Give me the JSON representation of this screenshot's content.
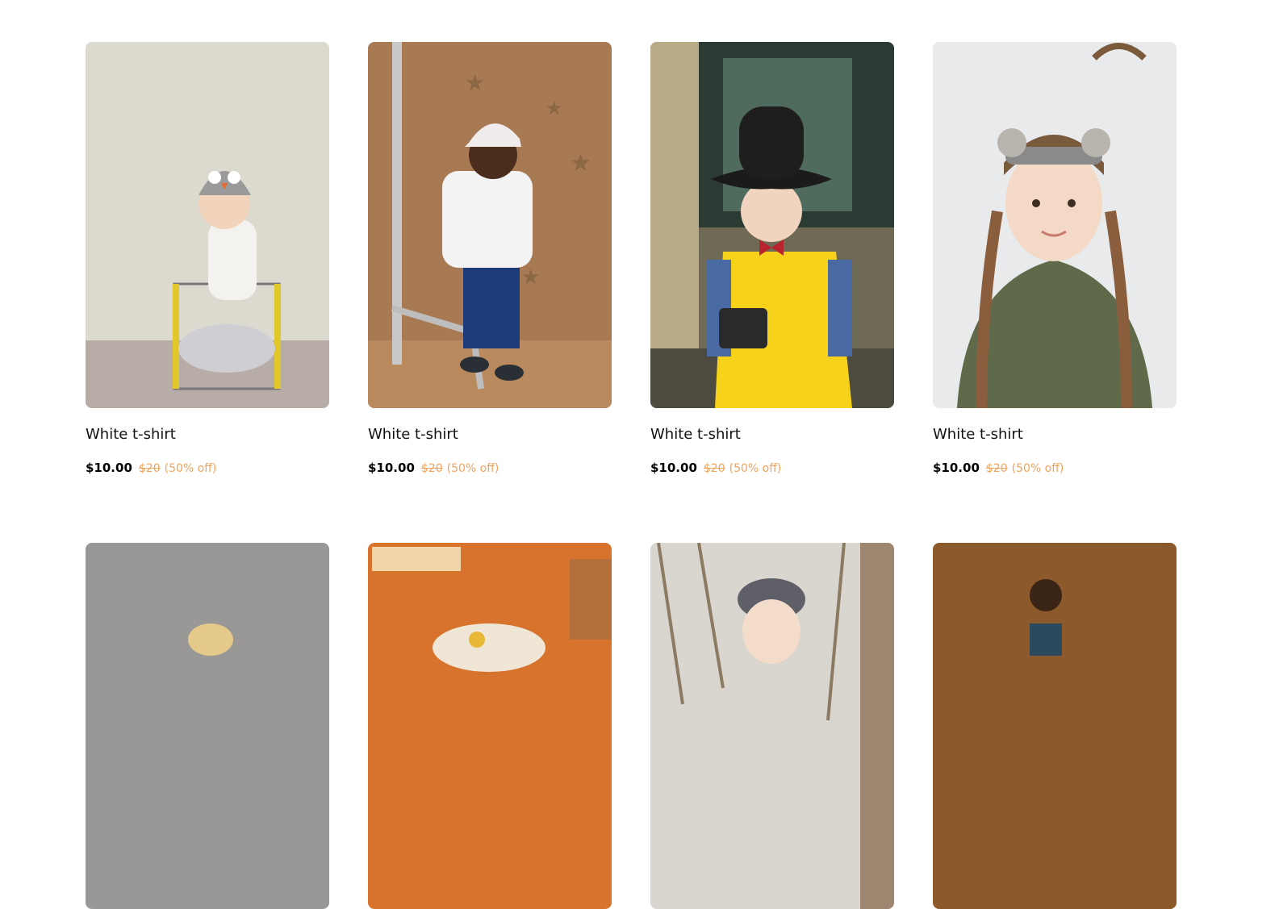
{
  "products": [
    {
      "title": "White t-shirt",
      "price": "$10.00",
      "old_price": "$20",
      "discount": "(50% off)",
      "image": "baby-owl-hat-photo"
    },
    {
      "title": "White t-shirt",
      "price": "$10.00",
      "old_price": "$20",
      "discount": "(50% off)",
      "image": "toddler-cap-photo"
    },
    {
      "title": "White t-shirt",
      "price": "$10.00",
      "old_price": "$20",
      "discount": "(50% off)",
      "image": "boy-fedora-camera-photo"
    },
    {
      "title": "White t-shirt",
      "price": "$10.00",
      "old_price": "$20",
      "discount": "(50% off)",
      "image": "girl-braids-photo"
    },
    {
      "image": "toddler-gray-wall-photo"
    },
    {
      "image": "child-orange-room-photo"
    },
    {
      "image": "toddler-beret-trees-photo"
    },
    {
      "image": "boy-glasses-brown-photo"
    }
  ]
}
